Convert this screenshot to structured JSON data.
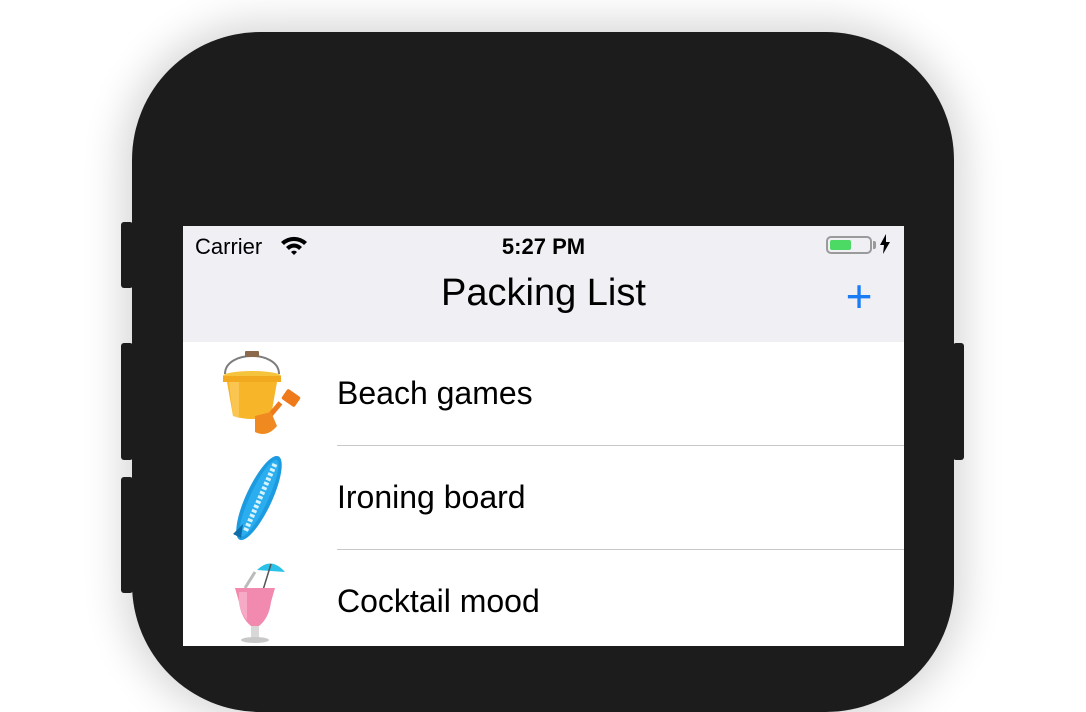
{
  "status_bar": {
    "carrier": "Carrier",
    "time": "5:27 PM",
    "battery_level": 0.55,
    "charging": true
  },
  "nav": {
    "title": "Packing List",
    "add_label": "+"
  },
  "items": [
    {
      "label": "Beach games",
      "icon": "sand-bucket-icon"
    },
    {
      "label": "Ironing board",
      "icon": "surfboard-icon"
    },
    {
      "label": "Cocktail mood",
      "icon": "cocktail-icon"
    }
  ],
  "colors": {
    "accent": "#1a7cf5",
    "navbar_bg": "#efeff4",
    "battery_green": "#4cd964",
    "device_body": "#1c1c1c"
  }
}
